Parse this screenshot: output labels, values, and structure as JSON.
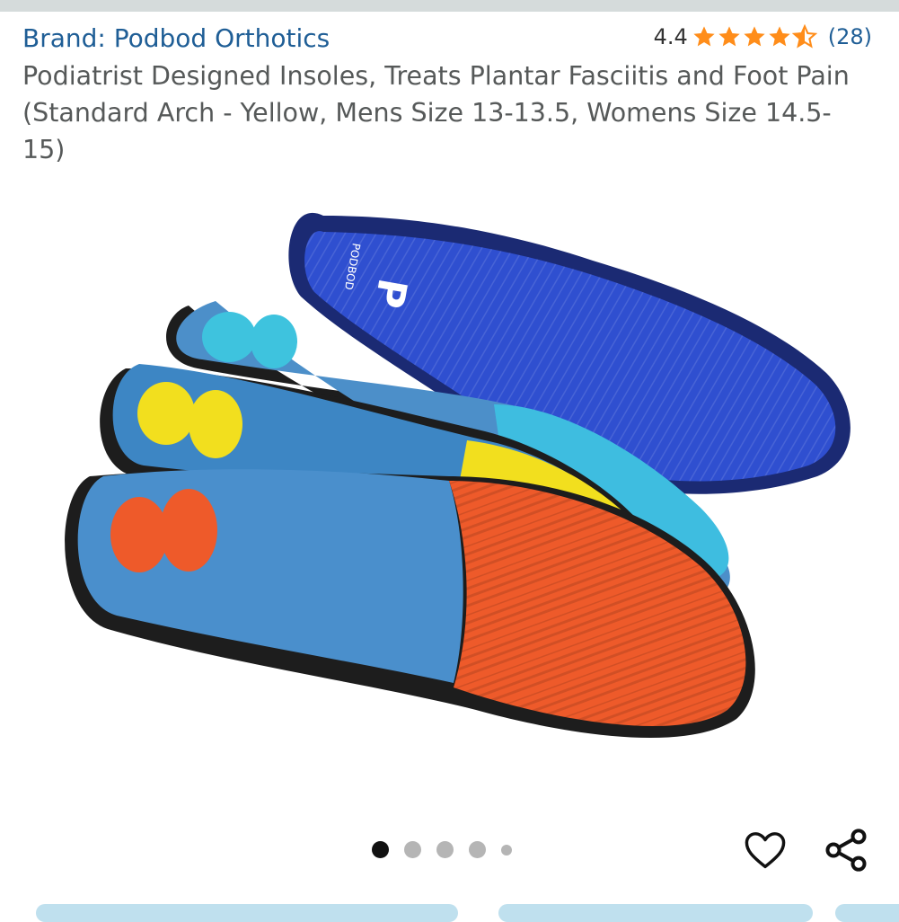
{
  "product": {
    "brand": "Brand: Podbod Orthotics",
    "title": "Podiatrist Designed Insoles, Treats Plantar Fasciitis and Foot Pain (Standard Arch - Yellow, Mens Size 13-13.5, Womens Size 14.5-15)",
    "rating_value": "4.4",
    "rating": 4.4,
    "rating_count": "(28)",
    "image_logo_text": "PODBOD",
    "image_logo_letter": "P"
  },
  "gallery": {
    "image_count": 5,
    "active_index": 1
  },
  "actions": {
    "favorite_icon": "heart-outline-icon",
    "share_icon": "share-icon"
  },
  "colors": {
    "link": "#1f5e96",
    "star": "#ff8d1a",
    "text": "#565959"
  }
}
